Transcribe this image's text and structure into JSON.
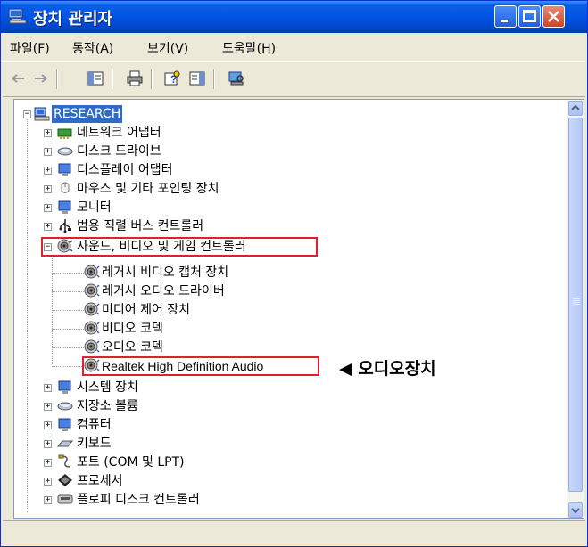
{
  "window": {
    "title": "장치 관리자",
    "title_icon": "computer-icon"
  },
  "menu": [
    "파일(F)",
    "동작(A)",
    "보기(V)",
    "도움말(H)"
  ],
  "toolbar": {
    "buttons": [
      "back-arrow-icon",
      "forward-arrow-icon",
      "console-tree-icon",
      "print-icon",
      "help-icon",
      "properties-pane-icon",
      "scan-hardware-icon"
    ]
  },
  "tree": {
    "root": "RESEARCH",
    "categories_before": [
      {
        "label": "네트워크 어댑터",
        "icon": "network-adapter-icon"
      },
      {
        "label": "디스크 드라이브",
        "icon": "disk-drive-icon"
      },
      {
        "label": "디스플레이 어댑터",
        "icon": "display-adapter-icon"
      },
      {
        "label": "마우스 및 기타 포인팅 장치",
        "icon": "mouse-icon"
      },
      {
        "label": "모니터",
        "icon": "monitor-icon"
      },
      {
        "label": "범용 직렬 버스 컨트롤러",
        "icon": "usb-icon"
      }
    ],
    "expanded_category": {
      "label": "사운드, 비디오 및 게임 컨트롤러",
      "icon": "speaker-icon",
      "children": [
        "레거시 비디오 캡처 장치",
        "레거시 오디오 드라이버",
        "미디어 제어 장치",
        "비디오 코덱",
        "오디오 코덱",
        "Realtek High Definition Audio"
      ]
    },
    "categories_after": [
      {
        "label": "시스템 장치",
        "icon": "system-device-icon"
      },
      {
        "label": "저장소 볼륨",
        "icon": "storage-volume-icon"
      },
      {
        "label": "컴퓨터",
        "icon": "computer-icon"
      },
      {
        "label": "키보드",
        "icon": "keyboard-icon"
      },
      {
        "label": "포트 (COM 및 LPT)",
        "icon": "port-icon"
      },
      {
        "label": "프로세서",
        "icon": "processor-icon"
      },
      {
        "label": "플로피 디스크 컨트롤러",
        "icon": "floppy-controller-icon"
      }
    ]
  },
  "annotation": {
    "text": "◀ 오디오장치",
    "box_color": "#e0202a"
  },
  "colors": {
    "titlebar": "#0054e3",
    "selection": "#316ac5",
    "highlight": "#e0202a"
  }
}
